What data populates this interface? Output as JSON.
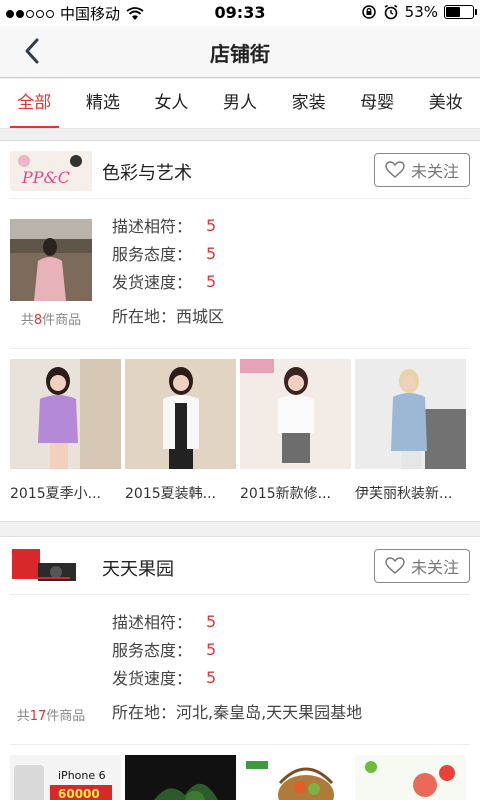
{
  "status_bar": {
    "carrier": "中国移动",
    "time": "09:33",
    "battery_percent_text": "53%",
    "battery_level": 0.53
  },
  "nav": {
    "title": "店铺街",
    "back_icon": "chevron-left-icon"
  },
  "tabs": [
    {
      "label": "全部",
      "active": true
    },
    {
      "label": "精选"
    },
    {
      "label": "女人"
    },
    {
      "label": "男人"
    },
    {
      "label": "家装"
    },
    {
      "label": "母婴"
    },
    {
      "label": "美妆"
    }
  ],
  "shops": [
    {
      "name": "色彩与艺术",
      "follow_label": "未关注",
      "count_prefix": "共",
      "count_num": "8",
      "count_suffix": "件商品",
      "ratings": [
        {
          "label": "描述相符：",
          "value": "5"
        },
        {
          "label": "服务态度：",
          "value": "5"
        },
        {
          "label": "发货速度：",
          "value": "5"
        }
      ],
      "location": "所在地：西城区",
      "products": [
        {
          "title": "2015夏季小..."
        },
        {
          "title": "2015夏装韩..."
        },
        {
          "title": "2015新款修..."
        },
        {
          "title": "伊芙丽秋装新..."
        }
      ]
    },
    {
      "name": "天天果园",
      "follow_label": "未关注",
      "count_prefix": "共",
      "count_num": "17",
      "count_suffix": "件商品",
      "ratings": [
        {
          "label": "描述相符：",
          "value": "5"
        },
        {
          "label": "服务态度：",
          "value": "5"
        },
        {
          "label": "发货速度：",
          "value": "5"
        }
      ],
      "location": "所在地：河北,秦皇岛,天天果园基地",
      "preview_texts": {
        "phone": "iPhone 6",
        "price": "60000"
      }
    }
  ],
  "colors": {
    "accent": "#e53333"
  }
}
